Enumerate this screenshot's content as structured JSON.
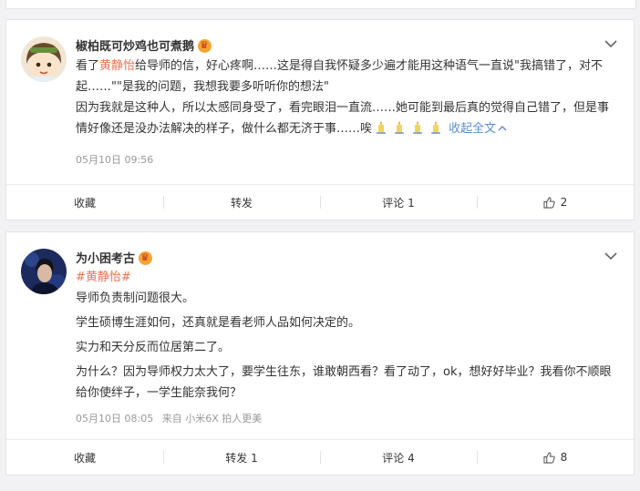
{
  "posts": [
    {
      "username": "椒柏既可炒鸡也可煮鹅",
      "text": {
        "line1_pre": "看了",
        "line1_link": "黄静怡",
        "line1_post": "给导师的信，好心疼啊……这是得自我怀疑多少遍才能用这种语气一直说\"我搞错了，对不起……\"\"是我的问题，我想我要多听听你的想法\"",
        "line2": "因为我就是这种人，所以太感同身受了，看完眼泪一直流……她可能到最后真的觉得自己错了，但是事情好像还是没办法解决的样子，做什么都无济于事……唉",
        "collapse": "收起全文"
      },
      "meta": {
        "time": "05月10日 09:56"
      },
      "actions": {
        "favorite": "收藏",
        "repost": "转发",
        "comment": "评论 1",
        "like": "2"
      },
      "icons": {
        "badge": "crown-icon",
        "menu": "chevron-down-icon",
        "emoji": "candle-emoji",
        "like": "thumbs-up-icon"
      }
    },
    {
      "username": "为小困考古",
      "text": {
        "hashtag": "#黄静怡#",
        "p1": "导师负责制问题很大。",
        "p2": "学生硕博生涯如何，还真就是看老师人品如何决定的。",
        "p3": "实力和天分反而位居第二了。",
        "p4": "为什么？因为导师权力太大了，要学生往东，谁敢朝西看？看了动了，ok，想好好毕业？我看你不顺眼给你使绊子，一学生能奈我何？"
      },
      "meta": {
        "time": "05月10日 08:05",
        "source": "来自 小米6X 拍人更美"
      },
      "actions": {
        "favorite": "收藏",
        "repost": "转发 1",
        "comment": "评论 4",
        "like": "8"
      },
      "icons": {
        "badge": "crown-icon",
        "menu": "chevron-down-icon",
        "like": "thumbs-up-icon"
      }
    }
  ],
  "colors": {
    "link": "#eb7350",
    "blue": "#5a8fcf",
    "meta": "#999999",
    "background": "#f2f2f5"
  }
}
